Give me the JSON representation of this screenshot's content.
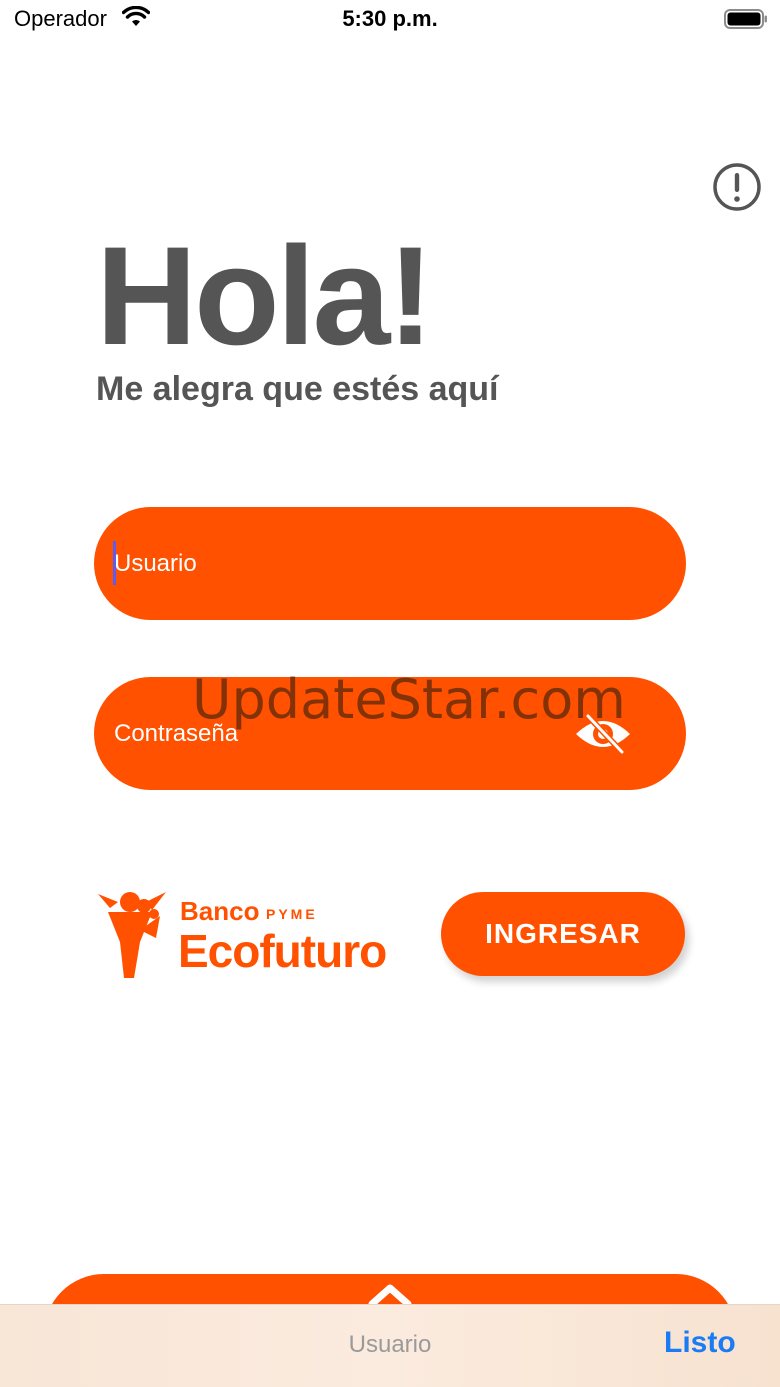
{
  "status_bar": {
    "carrier": "Operador",
    "time": "5:30 p.m.",
    "icons": [
      "wifi-icon",
      "battery-icon"
    ]
  },
  "header": {
    "info_icon": "exclamation-circle-icon"
  },
  "hero": {
    "title": "Hola!",
    "subtitle": "Me alegra que estés aquí"
  },
  "form": {
    "username": {
      "placeholder": "Usuario",
      "value": ""
    },
    "password": {
      "placeholder": "Contraseña",
      "value": "",
      "toggle_icon": "eye-slash-icon"
    },
    "login_label": "INGRESAR"
  },
  "brand": {
    "banco": "Banco",
    "pyme": "PYME",
    "name": "Ecofuturo"
  },
  "watermark": "UpdateStar.com",
  "keyboard_toolbar": {
    "field_label": "Usuario",
    "done_label": "Listo"
  },
  "colors": {
    "accent": "#ff5100",
    "text_dark": "#555555",
    "caret": "#5a5cf2",
    "done_link": "#1a7cf5",
    "toolbar_bg": "#f9e7d9"
  }
}
